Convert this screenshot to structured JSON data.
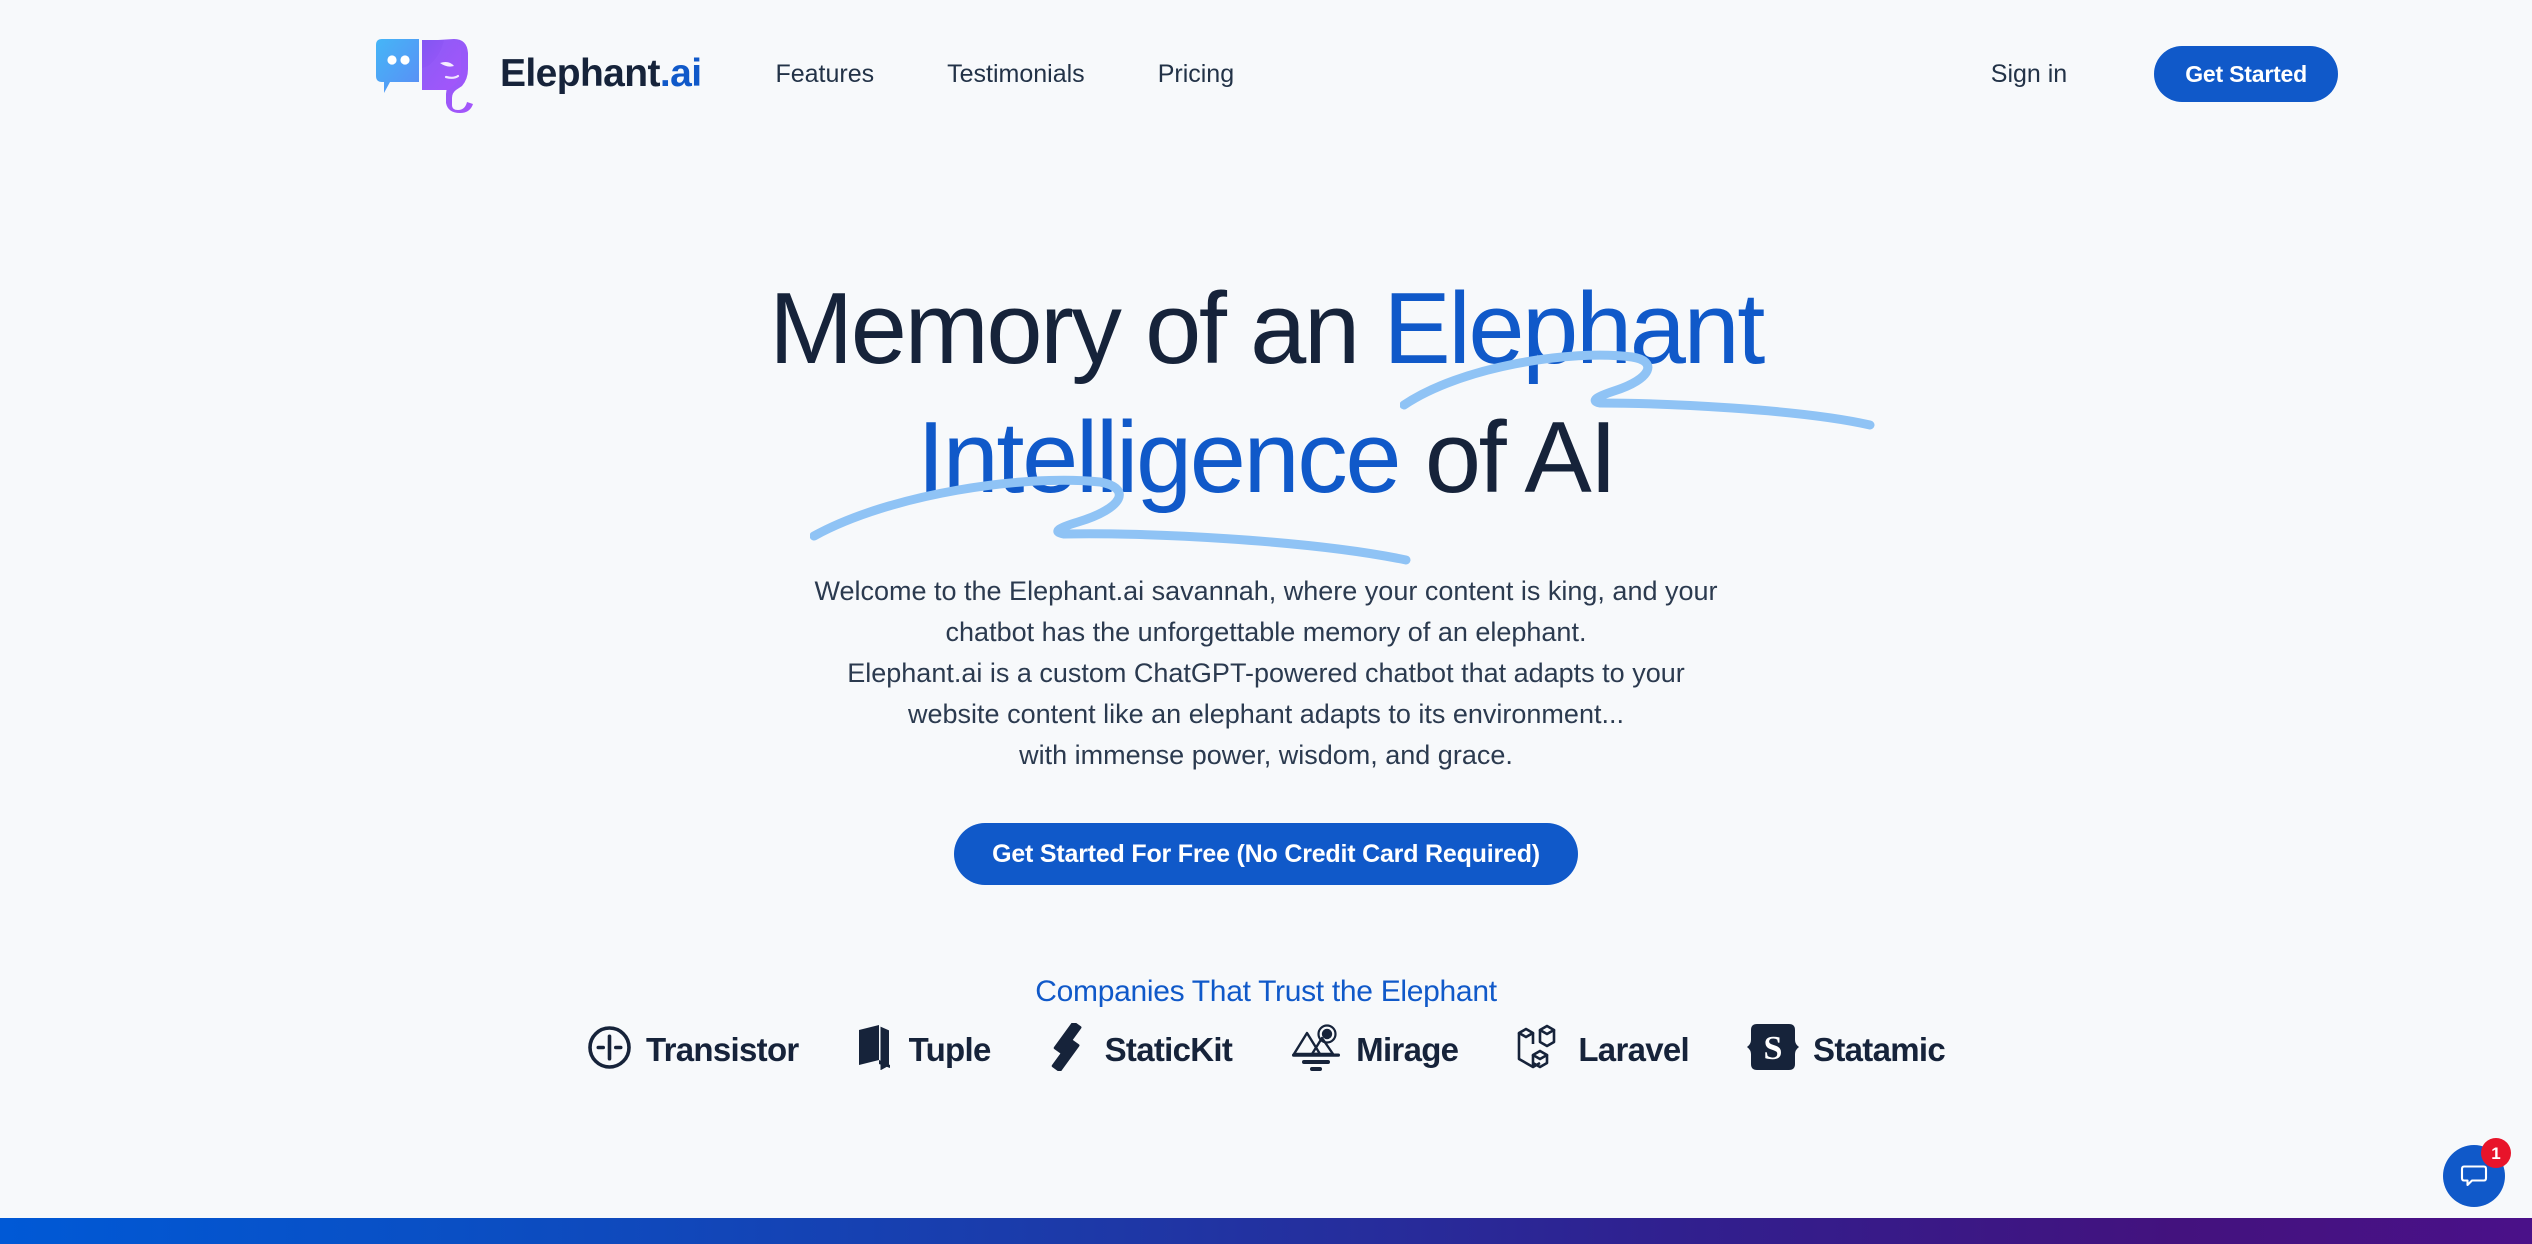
{
  "brand": {
    "name_main": "Elephant",
    "name_suffix": ".ai",
    "logo_icon": "elephant-chat-bubble-logo"
  },
  "nav": {
    "links": [
      {
        "label": "Features"
      },
      {
        "label": "Testimonials"
      },
      {
        "label": "Pricing"
      }
    ],
    "signin_label": "Sign in",
    "get_started_label": "Get Started"
  },
  "hero": {
    "headline": {
      "line1_plain": "Memory of an ",
      "line1_accent": "Elephant",
      "line2_accent": "Intelligence",
      "line2_plain": " of AI"
    },
    "subcopy_lines": [
      "Welcome to the Elephant.ai savannah, where your content is king, and your",
      "chatbot has the unforgettable memory of an elephant.",
      "Elephant.ai is a custom ChatGPT-powered chatbot that adapts to your",
      "website content like an elephant adapts to its environment...",
      "with immense power, wisdom, and grace."
    ],
    "cta_label": "Get Started For Free (No Credit Card Required)"
  },
  "trust": {
    "title": "Companies That Trust the Elephant",
    "logos": [
      {
        "name": "Transistor",
        "icon": "transistor-icon"
      },
      {
        "name": "Tuple",
        "icon": "tuple-icon"
      },
      {
        "name": "StaticKit",
        "icon": "statickit-icon"
      },
      {
        "name": "Mirage",
        "icon": "mirage-icon"
      },
      {
        "name": "Laravel",
        "icon": "laravel-icon"
      },
      {
        "name": "Statamic",
        "icon": "statamic-icon"
      }
    ]
  },
  "chat": {
    "icon": "chat-bubble-icon",
    "badge_count": "1"
  },
  "colors": {
    "accent_blue": "#1059c9",
    "heading_navy": "#16233a",
    "page_bg": "#f7f9fb",
    "swoosh_blue": "#8fc3f5",
    "badge_red": "#e8142a",
    "gradient_start": "#0059d6",
    "gradient_end": "#4a1189",
    "logo_bubble_blue": "#3aa4f0",
    "logo_elephant_purple": "#9b4dfb"
  }
}
